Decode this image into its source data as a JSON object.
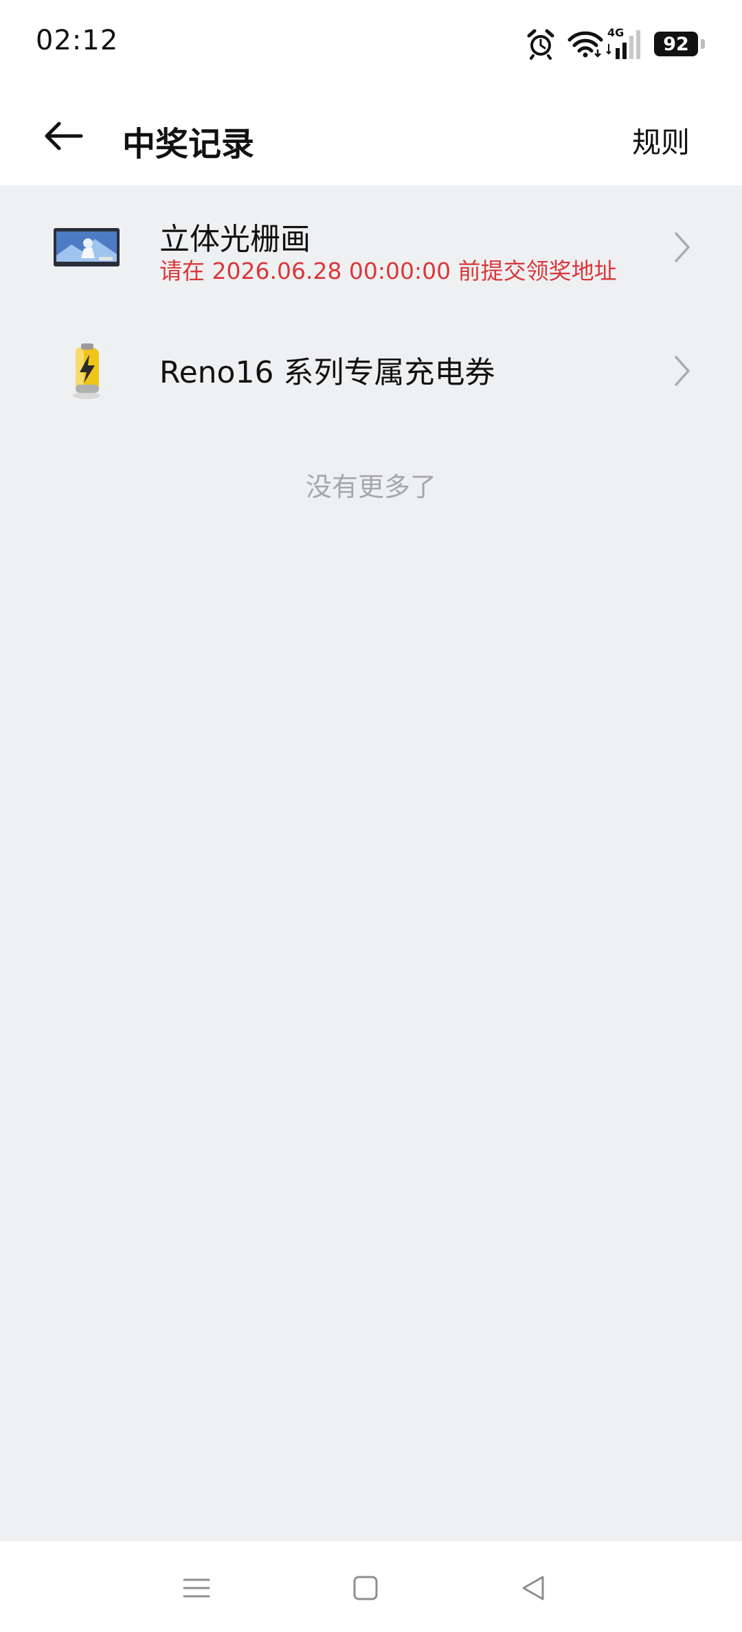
{
  "status_bar": {
    "time": "02:12",
    "network": "4G",
    "battery": "92",
    "icons": [
      "alarm-icon",
      "wifi-icon",
      "cellular-signal-icon",
      "battery-icon"
    ]
  },
  "header": {
    "title": "中奖记录",
    "rules_label": "规则",
    "back_icon": "arrow-left-icon"
  },
  "records": [
    {
      "title": "立体光栅画",
      "subtitle": "请在 2026.06.28 00:00:00 前提交领奖地址",
      "thumbnail": "artwork-thumbnail"
    },
    {
      "title": "Reno16 系列专属充电券",
      "thumbnail": "battery-charge-icon"
    }
  ],
  "end_message": "没有更多了",
  "colors": {
    "background": "#eff0f2",
    "surface": "#ffffff",
    "accent_red": "#d9373a",
    "muted": "#a6a7ab"
  },
  "nav_bar": {
    "icons": [
      "menu-icon",
      "home-icon",
      "back-triangle-icon"
    ]
  }
}
